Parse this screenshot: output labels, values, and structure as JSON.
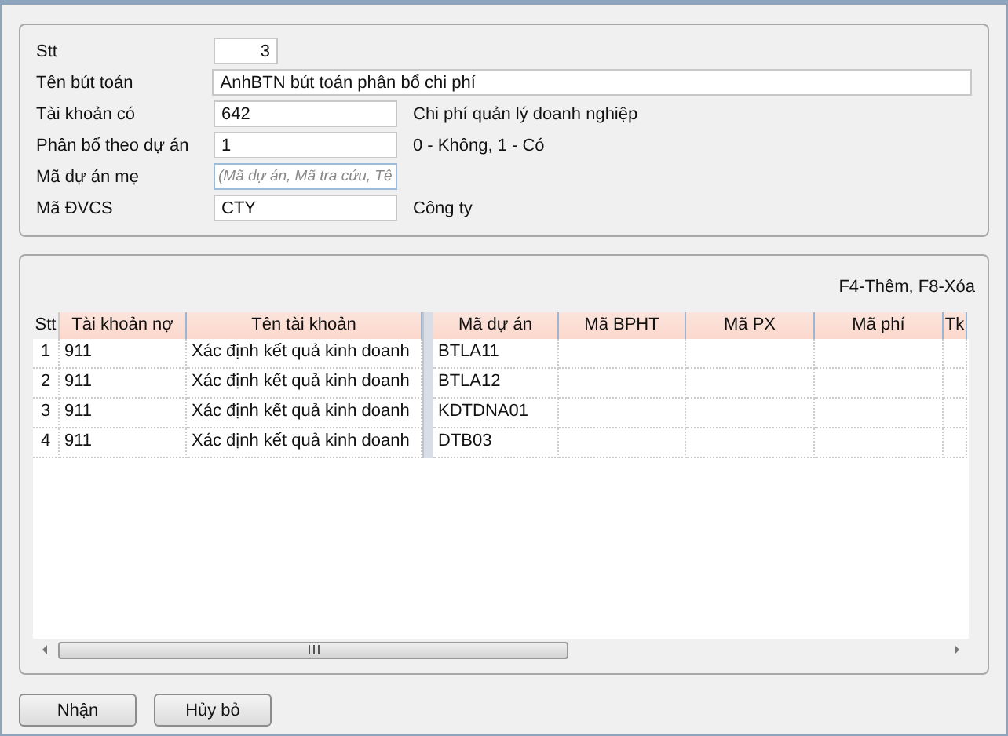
{
  "form": {
    "fields": [
      {
        "label": "Stt",
        "kind": "number",
        "value": "3"
      },
      {
        "label": "Tên bút toán",
        "kind": "wide",
        "value": "AnhBTN bút toán phân bổ chi phí"
      },
      {
        "label": "Tài khoản có",
        "kind": "medium",
        "value": "642",
        "note": "Chi phí quản lý doanh nghiệp"
      },
      {
        "label": "Phân bổ theo dự án",
        "kind": "medium",
        "value": "1",
        "note": "0 - Không, 1 - Có"
      },
      {
        "label": "Mã dự án mẹ",
        "kind": "lookup",
        "placeholder": "(Mã dự án, Mã tra cứu, Tê"
      },
      {
        "label": "Mã ĐVCS",
        "kind": "medium",
        "value": "CTY",
        "note": "Công ty"
      }
    ]
  },
  "grid": {
    "hint": "F4-Thêm, F8-Xóa",
    "columns": [
      "Stt",
      "Tài khoản nợ",
      "Tên tài khoản",
      "Mã dự án",
      "Mã BPHT",
      "Mã PX",
      "Mã phí",
      "Tk"
    ],
    "rows": [
      {
        "stt": "1",
        "account": "911",
        "name": "Xác định kết quả kinh doanh",
        "project": "BTLA11"
      },
      {
        "stt": "2",
        "account": "911",
        "name": "Xác định kết quả kinh doanh",
        "project": "BTLA12"
      },
      {
        "stt": "3",
        "account": "911",
        "name": "Xác định kết quả kinh doanh",
        "project": "KDTDNA01"
      },
      {
        "stt": "4",
        "account": "911",
        "name": "Xác định kết quả kinh doanh",
        "project": "DTB03"
      }
    ]
  },
  "buttons": [
    "Nhận",
    "Hủy bỏ"
  ]
}
